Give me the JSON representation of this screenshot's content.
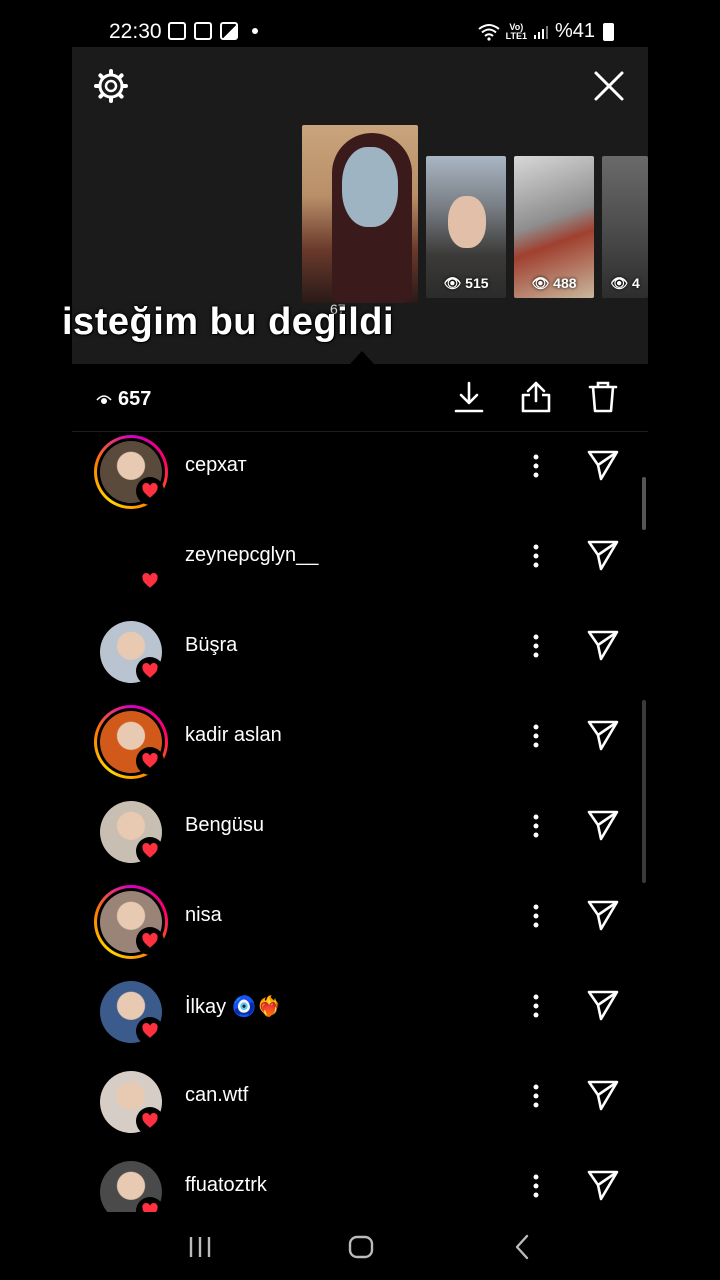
{
  "status_bar": {
    "time": "22:30",
    "battery": "%41",
    "network": "LTE1",
    "icons": [
      "screenshot-icon",
      "screenshot-icon",
      "gallery-icon",
      "dot-icon",
      "wifi-icon",
      "volte-icon",
      "signal-icon",
      "battery-icon"
    ]
  },
  "story_panel": {
    "caption": "isteğim bu degildi",
    "thumbnails": [
      {
        "views": "657",
        "selected": true
      },
      {
        "views": "515"
      },
      {
        "views": "488"
      },
      {
        "views": "4"
      }
    ],
    "selected_views_partial": "67"
  },
  "actions": {
    "view_count": "657",
    "icons": [
      "download-icon",
      "share-icon",
      "trash-icon"
    ]
  },
  "viewers": [
    {
      "username": "серхат",
      "ring": true,
      "avatar_color": "#5a4a3c"
    },
    {
      "username": "zeynepcglyn__",
      "ring": false,
      "avatar_color": "#000000"
    },
    {
      "username": "Büşra",
      "ring": false,
      "avatar_color": "#b9c4d0"
    },
    {
      "username": "kadir aslan",
      "ring": true,
      "avatar_color": "#d15a1a"
    },
    {
      "username": "Bengüsu",
      "ring": false,
      "avatar_color": "#c8bfb2"
    },
    {
      "username": "nisa",
      "ring": true,
      "avatar_color": "#9a8478"
    },
    {
      "username": "İlkay 🧿❤️‍🔥",
      "ring": false,
      "avatar_color": "#3b5b8c"
    },
    {
      "username": "can.wtf",
      "ring": false,
      "avatar_color": "#d6cdc6"
    },
    {
      "username": "ffuatoztrk",
      "ring": false,
      "avatar_color": "#4a4a4a"
    }
  ],
  "colors": {
    "background": "#000000",
    "panel": "#1b1b1b",
    "heart": "#ff3040"
  }
}
